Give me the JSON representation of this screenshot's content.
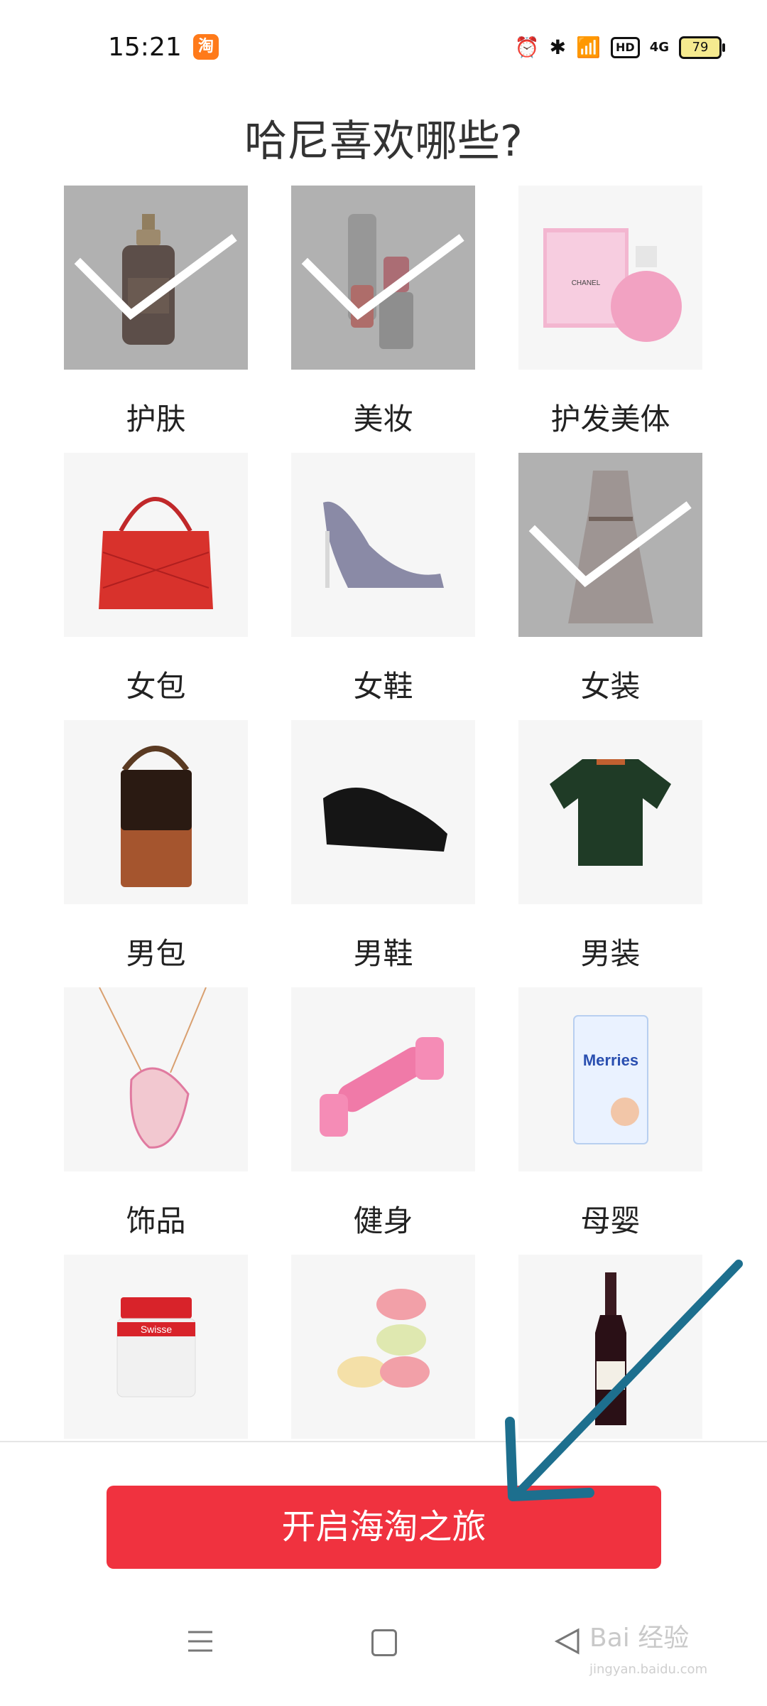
{
  "status": {
    "time": "15:21",
    "app_badge": "淘",
    "network": "4G",
    "hd": "HD",
    "battery": "79"
  },
  "page": {
    "title": "哈尼喜欢哪些?"
  },
  "categories": [
    {
      "label": "护肤",
      "selected": true,
      "icon": "serum-bottle-icon"
    },
    {
      "label": "美妆",
      "selected": true,
      "icon": "lipstick-icon"
    },
    {
      "label": "护发美体",
      "selected": false,
      "icon": "perfume-icon"
    },
    {
      "label": "女包",
      "selected": false,
      "icon": "handbag-icon"
    },
    {
      "label": "女鞋",
      "selected": false,
      "icon": "high-heel-icon"
    },
    {
      "label": "女装",
      "selected": true,
      "icon": "dress-icon"
    },
    {
      "label": "男包",
      "selected": false,
      "icon": "mens-bag-icon"
    },
    {
      "label": "男鞋",
      "selected": false,
      "icon": "mens-shoe-icon"
    },
    {
      "label": "男装",
      "selected": false,
      "icon": "polo-shirt-icon"
    },
    {
      "label": "饰品",
      "selected": false,
      "icon": "necklace-icon"
    },
    {
      "label": "健身",
      "selected": false,
      "icon": "dumbbell-icon"
    },
    {
      "label": "母婴",
      "selected": false,
      "icon": "diaper-pack-icon"
    },
    {
      "label": "",
      "selected": false,
      "icon": "supplement-jar-icon"
    },
    {
      "label": "",
      "selected": false,
      "icon": "macarons-icon"
    },
    {
      "label": "",
      "selected": false,
      "icon": "wine-bottle-icon"
    }
  ],
  "product_text": {
    "perfume_brand": "CHANEL",
    "diaper_brand": "Merries",
    "supplement_brand": "Swisse"
  },
  "cta": {
    "label": "开启海淘之旅"
  },
  "watermark": {
    "brand": "Bai 经验",
    "url": "jingyan.baidu.com"
  },
  "colors": {
    "accent": "#f0323f",
    "arrow": "#1d6f8e"
  }
}
